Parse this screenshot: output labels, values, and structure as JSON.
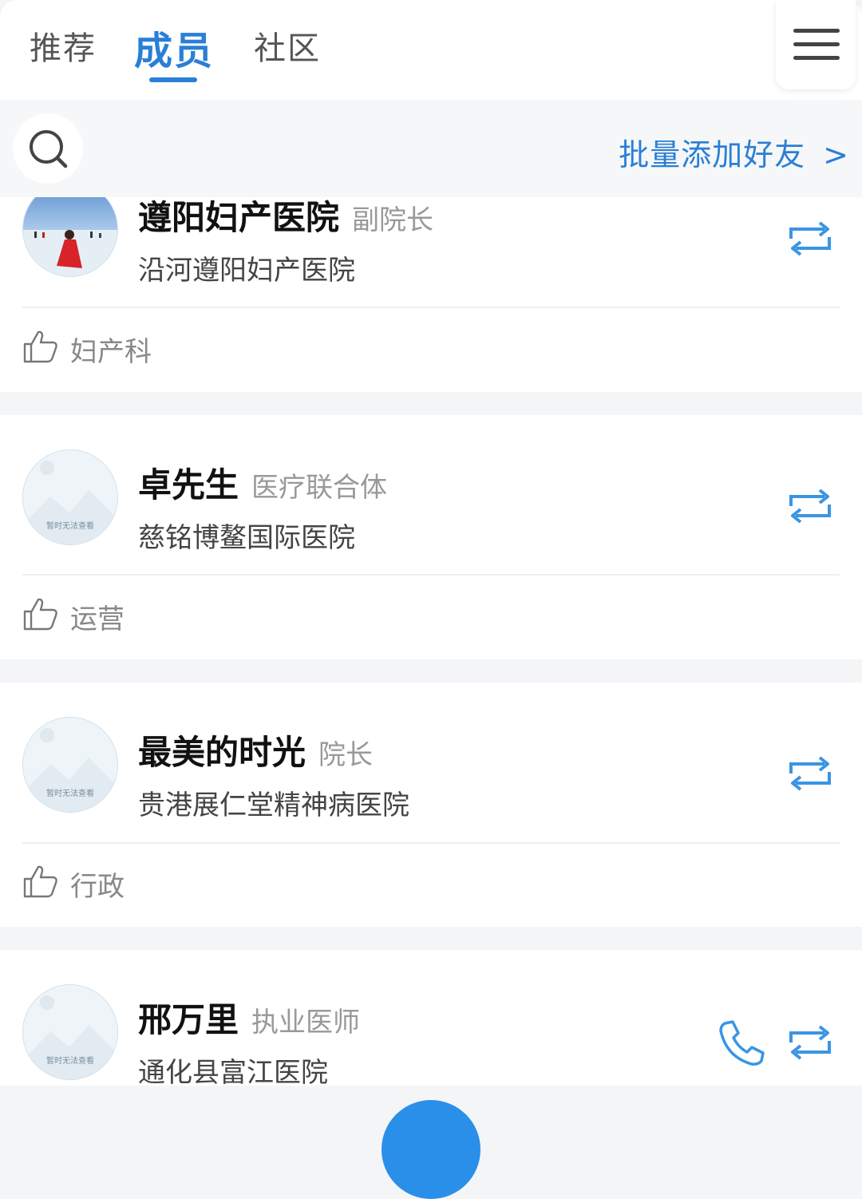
{
  "tabs": [
    {
      "label": "推荐"
    },
    {
      "label": "成员"
    },
    {
      "label": "社区"
    }
  ],
  "batch_add": {
    "label": "批量添加好友",
    "chevron": ">"
  },
  "avatar_placeholder_text": "暂时无法查看",
  "members": [
    {
      "name": "遵阳妇产医院",
      "role": "副院长",
      "org": "沿河遵阳妇产医院",
      "dept": "妇产科"
    },
    {
      "name": "卓先生",
      "role": "医疗联合体",
      "org": "慈铭博鳌国际医院",
      "dept": "运营"
    },
    {
      "name": "最美的时光",
      "role": "院长",
      "org": "贵港展仁堂精神病医院",
      "dept": "行政"
    },
    {
      "name": "邢万里",
      "role": "执业医师",
      "org": "通化县富江医院"
    }
  ],
  "colors": {
    "accent": "#2a7fd6",
    "icon_blue": "#3a95e3"
  }
}
